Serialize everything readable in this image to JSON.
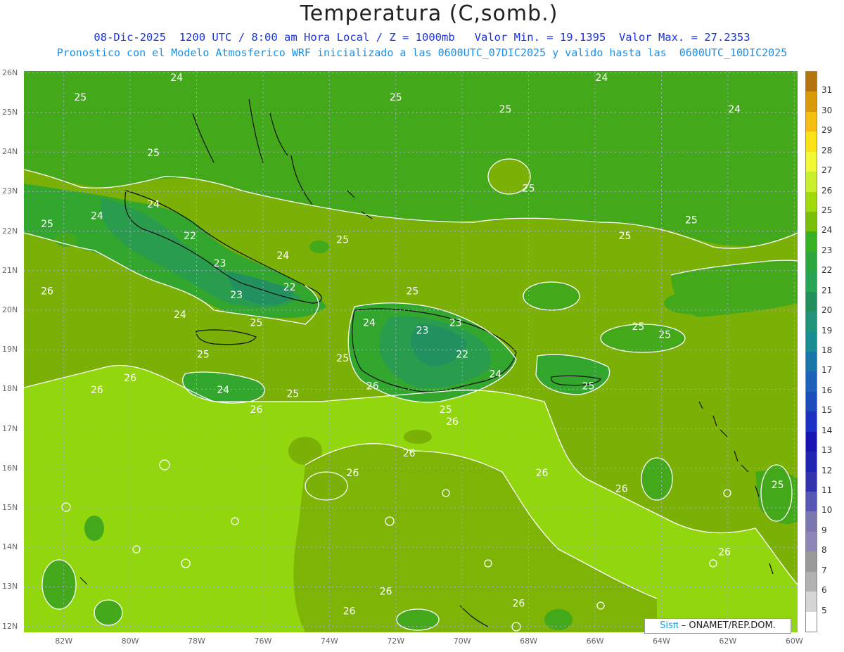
{
  "header": {
    "title": "Temperatura (C,somb.)",
    "subtitle": "08-Dic-2025  1200 UTC / 8:00 am Hora Local / Z = 1000mb   Valor Min. = 19.1395  Valor Max. = 27.2353",
    "subtitle2": "Pronostico con el Modelo Atmosferico WRF inicializado a las 0600UTC_07DIC2025 y valido hasta las  0600UTC_10DIC2025"
  },
  "map": {
    "lat_labels": [
      "26N",
      "25N",
      "24N",
      "23N",
      "22N",
      "21N",
      "20N",
      "19N",
      "18N",
      "17N",
      "16N",
      "15N",
      "14N",
      "13N",
      "12N"
    ],
    "lon_labels": [
      "82W",
      "80W",
      "78W",
      "76W",
      "74W",
      "72W",
      "70W",
      "68W",
      "66W",
      "64W",
      "62W",
      "60W"
    ],
    "contour_labels": [
      {
        "text": "24",
        "lon": -78.6,
        "lat": 25.8
      },
      {
        "text": "25",
        "lon": -81.5,
        "lat": 25.3
      },
      {
        "text": "25",
        "lon": -79.3,
        "lat": 23.9
      },
      {
        "text": "24",
        "lon": -79.3,
        "lat": 22.6
      },
      {
        "text": "24",
        "lon": -81.0,
        "lat": 22.3
      },
      {
        "text": "25",
        "lon": -82.5,
        "lat": 22.1
      },
      {
        "text": "22",
        "lon": -78.2,
        "lat": 21.8
      },
      {
        "text": "23",
        "lon": -77.3,
        "lat": 21.1
      },
      {
        "text": "24",
        "lon": -75.4,
        "lat": 21.3
      },
      {
        "text": "25",
        "lon": -73.6,
        "lat": 21.7
      },
      {
        "text": "22",
        "lon": -75.2,
        "lat": 20.5
      },
      {
        "text": "23",
        "lon": -76.8,
        "lat": 20.3
      },
      {
        "text": "24",
        "lon": -78.5,
        "lat": 19.8
      },
      {
        "text": "25",
        "lon": -76.2,
        "lat": 19.6
      },
      {
        "text": "26",
        "lon": -82.5,
        "lat": 20.4
      },
      {
        "text": "25",
        "lon": -72.0,
        "lat": 25.3
      },
      {
        "text": "25",
        "lon": -68.7,
        "lat": 25.0
      },
      {
        "text": "25",
        "lon": -68.0,
        "lat": 23.0
      },
      {
        "text": "24",
        "lon": -65.8,
        "lat": 25.8
      },
      {
        "text": "24",
        "lon": -61.8,
        "lat": 25.0
      },
      {
        "text": "25",
        "lon": -63.1,
        "lat": 22.2
      },
      {
        "text": "25",
        "lon": -65.1,
        "lat": 21.8
      },
      {
        "text": "25",
        "lon": -71.5,
        "lat": 20.4
      },
      {
        "text": "24",
        "lon": -72.8,
        "lat": 19.6
      },
      {
        "text": "23",
        "lon": -71.2,
        "lat": 19.4
      },
      {
        "text": "23",
        "lon": -70.2,
        "lat": 19.6
      },
      {
        "text": "22",
        "lon": -70.0,
        "lat": 18.8
      },
      {
        "text": "24",
        "lon": -69.0,
        "lat": 18.3
      },
      {
        "text": "25",
        "lon": -73.6,
        "lat": 18.7
      },
      {
        "text": "26",
        "lon": -72.7,
        "lat": 18.0
      },
      {
        "text": "25",
        "lon": -70.5,
        "lat": 17.4
      },
      {
        "text": "26",
        "lon": -70.3,
        "lat": 17.1
      },
      {
        "text": "25",
        "lon": -64.7,
        "lat": 19.5
      },
      {
        "text": "25",
        "lon": -63.9,
        "lat": 19.3
      },
      {
        "text": "25",
        "lon": -66.2,
        "lat": 18.0
      },
      {
        "text": "25",
        "lon": -77.8,
        "lat": 18.8
      },
      {
        "text": "24",
        "lon": -77.2,
        "lat": 17.9
      },
      {
        "text": "25",
        "lon": -75.1,
        "lat": 17.8
      },
      {
        "text": "26",
        "lon": -76.2,
        "lat": 17.4
      },
      {
        "text": "26",
        "lon": -80.0,
        "lat": 18.2
      },
      {
        "text": "26",
        "lon": -81.0,
        "lat": 17.9
      },
      {
        "text": "26",
        "lon": -71.6,
        "lat": 16.3
      },
      {
        "text": "26",
        "lon": -73.3,
        "lat": 15.8
      },
      {
        "text": "26",
        "lon": -67.6,
        "lat": 15.8
      },
      {
        "text": "26",
        "lon": -65.2,
        "lat": 15.4
      },
      {
        "text": "25",
        "lon": -60.5,
        "lat": 15.5
      },
      {
        "text": "26",
        "lon": -62.1,
        "lat": 13.8
      },
      {
        "text": "26",
        "lon": -72.3,
        "lat": 12.8
      },
      {
        "text": "26",
        "lon": -68.3,
        "lat": 12.5
      },
      {
        "text": "26",
        "lon": -73.4,
        "lat": 12.3
      }
    ]
  },
  "colorbar": {
    "levels": [
      "31",
      "30",
      "29",
      "28",
      "27",
      "26",
      "25",
      "24",
      "23",
      "22",
      "21",
      "20",
      "19",
      "18",
      "17",
      "16",
      "15",
      "14",
      "13",
      "12",
      "11",
      "10",
      "9",
      "8",
      "7",
      "6",
      "5"
    ],
    "colors": [
      "#b5730e",
      "#d99a08",
      "#f4bf12",
      "#fbe216",
      "#f2f838",
      "#cbee2d",
      "#a1da0a",
      "#7ac008",
      "#38b023",
      "#2ea63e",
      "#28a556",
      "#248f5e",
      "#21937a",
      "#1a8f93",
      "#1a75a8",
      "#1b62b8",
      "#1a4cbc",
      "#1b30c4",
      "#1613b3",
      "#1f24b1",
      "#3333b0",
      "#5858b4",
      "#7a78ae",
      "#8f86b8",
      "#9a9a9a",
      "#b1b1b1",
      "#d6d6d6",
      "#ffffff"
    ]
  },
  "credit": {
    "brand": "Sisπ",
    "text": "– ONAMET/REP.DOM."
  }
}
